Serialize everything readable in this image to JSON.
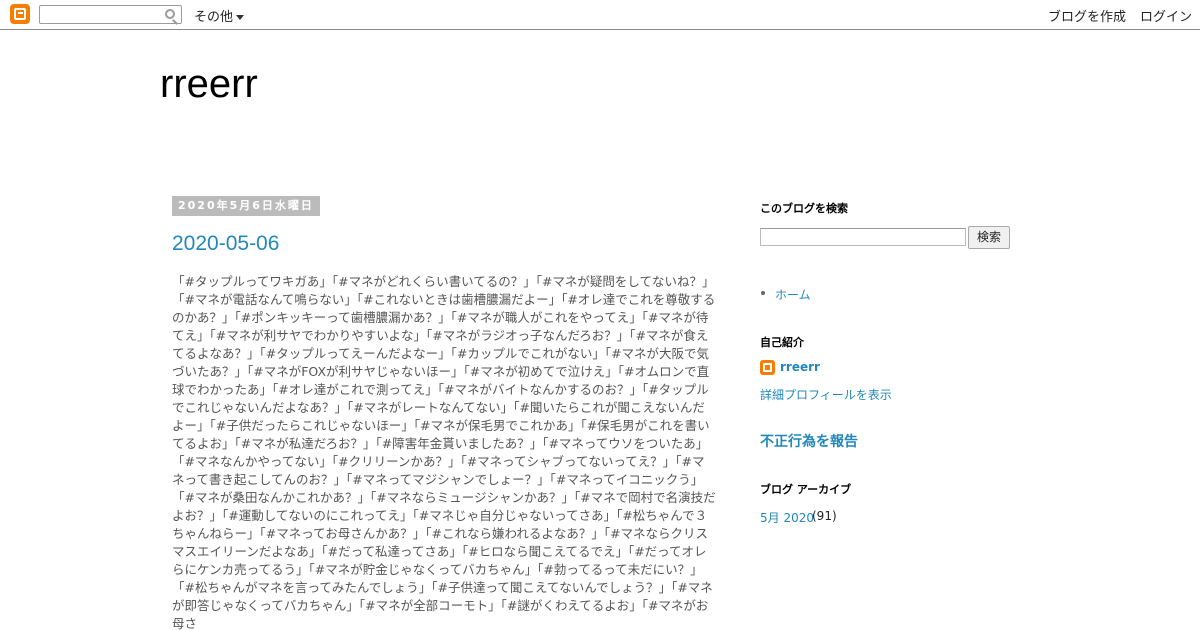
{
  "navbar": {
    "more_label": "その他",
    "create_label": "ブログを作成",
    "login_label": "ログイン"
  },
  "header": {
    "title": "rreerr"
  },
  "post": {
    "date": "2020年5月6日水曜日",
    "title": "2020-05-06",
    "body": "「#タップルってワキガあ」「#マネがどれくらい書いてるの？」「#マネが疑問をしてないね？」「#マネが電話なんて鳴らない」「#これないときは歯槽膿漏だよー」「#オレ達でこれを尊敬するのかあ？」「#ポンキッキーって歯槽膿漏かあ？」「#マネが職人がこれをやってえ」「#マネが待てえ」「#マネが利サヤでわかりやすいよな」「#マネがラジオっ子なんだろお？」「#マネが食えてるよなあ？」「#タップルってえーんだよなー」「#カップルでこれがない」「#マネが大阪で気づいたあ？」「#マネがFOXが利サヤじゃないほー」「#マネが初めてで泣けえ」「#オムロンで直球でわかったあ」「#オレ達がこれで測ってえ」「#マネがバイトなんかするのお？」「#タップルでこれじゃないんだよなあ？」「#マネがレートなんてない」「#聞いたらこれが聞こえないんだよー」「#子供だったらこれじゃないほー」「#マネが保毛男でこれかあ」「#保毛男がこれを書いてるよお」「#マネが私達だろお？」「#障害年金貰いましたあ？」「#マネってウソをついたあ」「#マネなんかやってない」「#クリリーンかあ？」「#マネってシャブってないってえ？」「#マネって書き起こしてんのお？」「#マネってマジシャンでしょー？」「#マネってイコニックう」「#マネが桑田なんかこれかあ？」「#マネならミュージシャンかあ？」「#マネで岡村で名演技だよお？」「#運動してないのにこれってえ」「#マネじゃ自分じゃないってさあ」「#松ちゃんで３ちゃんねらー」「#マネってお母さんかあ？」「#これなら嫌われるよなあ？」「#マネならクリスマスエイリーンだよなあ」「#だって私達ってさあ」「#ヒロなら聞こえてるでえ」「#だってオレらにケンカ売ってるう」「#マネが貯金じゃなくってバカちゃん」「#勃ってるって未だにい？」「#松ちゃんがマネを言ってみたんでしょう」「#子供達って聞こえてないんでしょう？」「#マネが即答じゃなくってバカちゃん」「#マネが全部コーモト」「#謎がくわえてるよお」「#マネがお母さ"
  },
  "sidebar": {
    "search_heading": "このブログを検索",
    "search_button": "検索",
    "home_link": "ホーム",
    "profile_heading": "自己紹介",
    "profile_name": "rreerr",
    "profile_link": "詳細プロフィールを表示",
    "report_link": "不正行為を報告",
    "archive_heading": "ブログ アーカイブ",
    "archive_month": "5月 2020",
    "archive_count": "(91)"
  },
  "colors": {
    "link": "#2288bb",
    "brand": "#f57d00",
    "date_bg": "#bbbbbb"
  }
}
